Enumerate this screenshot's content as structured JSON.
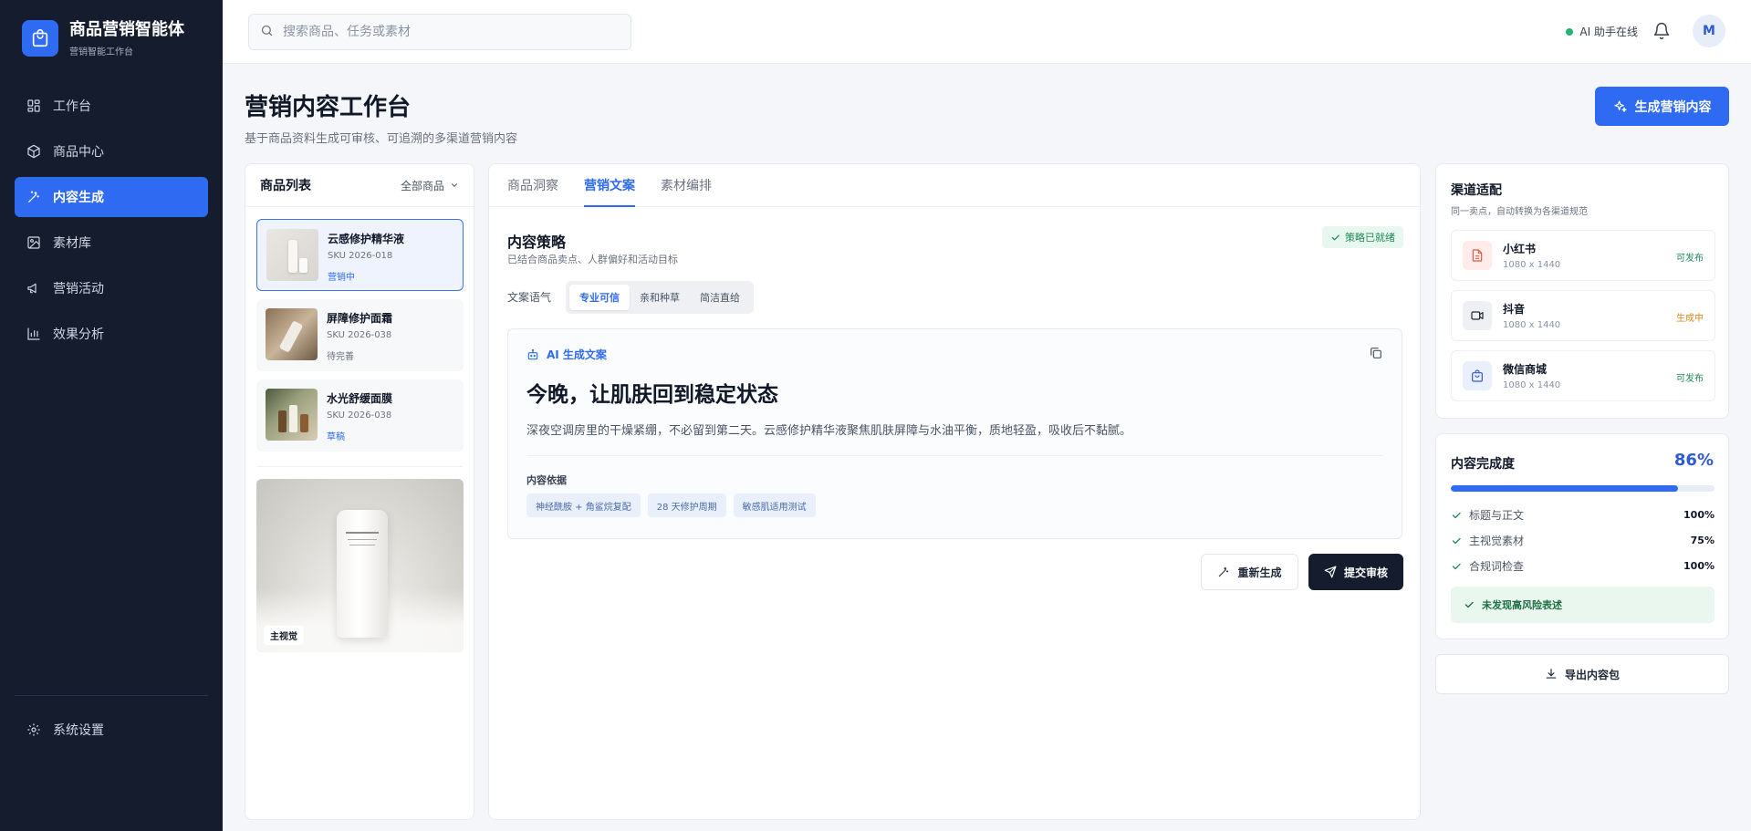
{
  "brand": {
    "title": "商品营销智能体",
    "subtitle": "营销智能工作台"
  },
  "sidebar": {
    "items": [
      {
        "label": "工作台",
        "icon": "dashboard-icon"
      },
      {
        "label": "商品中心",
        "icon": "box-icon"
      },
      {
        "label": "内容生成",
        "icon": "magic-wand-icon",
        "active": true
      },
      {
        "label": "素材库",
        "icon": "image-icon"
      },
      {
        "label": "营销活动",
        "icon": "megaphone-icon"
      },
      {
        "label": "效果分析",
        "icon": "bar-chart-icon"
      }
    ],
    "settings_label": "系统设置"
  },
  "topbar": {
    "search_placeholder": "搜索商品、任务或素材",
    "ai_status": "AI 助手在线",
    "avatar_initial": "M"
  },
  "page": {
    "title": "营销内容工作台",
    "subtitle": "基于商品资料生成可审核、可追溯的多渠道营销内容",
    "generate_button": "生成营销内容"
  },
  "products": {
    "title": "商品列表",
    "filter": "全部商品",
    "items": [
      {
        "name": "云感修护精华液",
        "sku": "SKU 2026-018",
        "status": "营销中",
        "status_color": "#2f6bf2",
        "selected": true
      },
      {
        "name": "屏障修护面霜",
        "sku": "SKU 2026-038",
        "status": "待完善",
        "status_color": "#6b7280"
      },
      {
        "name": "水光舒缓面膜",
        "sku": "SKU 2026-038",
        "status": "草稿",
        "status_color": "#2f6bf2"
      }
    ],
    "hero_tag": "主视觉"
  },
  "tabs": [
    "商品洞察",
    "营销文案",
    "素材编排"
  ],
  "active_tab": 1,
  "strategy": {
    "title": "内容策略",
    "subtitle": "已结合商品卖点、人群偏好和活动目标",
    "badge": "策略已就绪",
    "tone_label": "文案语气",
    "tones": [
      "专业可信",
      "亲和种草",
      "简洁直给"
    ],
    "active_tone": 0
  },
  "copy": {
    "label": "AI 生成文案",
    "headline": "今晚，让肌肤回到稳定状态",
    "body": "深夜空调房里的干燥紧绷，不必留到第二天。云感修护精华液聚焦肌肤屏障与水油平衡，质地轻盈，吸收后不黏腻。",
    "basis_label": "内容依据",
    "basis": [
      "神经酰胺 + 角鲨烷复配",
      "28 天修护周期",
      "敏感肌适用测试"
    ],
    "regenerate": "重新生成",
    "submit": "提交审核"
  },
  "channels": {
    "title": "渠道适配",
    "subtitle": "同一卖点，自动转换为各渠道规范",
    "items": [
      {
        "name": "小红书",
        "size": "1080 x 1440",
        "status": "可发布",
        "status_color": "#1f8a56",
        "icon": "document-icon"
      },
      {
        "name": "抖音",
        "size": "1080 x 1440",
        "status": "生成中",
        "status_color": "#d08a16",
        "icon": "video-icon"
      },
      {
        "name": "微信商城",
        "size": "1080 x 1440",
        "status": "可发布",
        "status_color": "#1f8a56",
        "icon": "shopping-bag-icon"
      }
    ]
  },
  "completion": {
    "title": "内容完成度",
    "percent_label": "86%",
    "percent": 86,
    "items": [
      {
        "label": "标题与正文",
        "value": "100%"
      },
      {
        "label": "主视觉素材",
        "value": "75%"
      },
      {
        "label": "合规词检查",
        "value": "100%"
      }
    ],
    "ok_message": "未发现高风险表述"
  },
  "export_label": "导出内容包",
  "colors": {
    "accent": "#2f6bf2",
    "sidebar_bg": "#141c2e",
    "success": "#1f8a56",
    "warning": "#d08a16"
  }
}
